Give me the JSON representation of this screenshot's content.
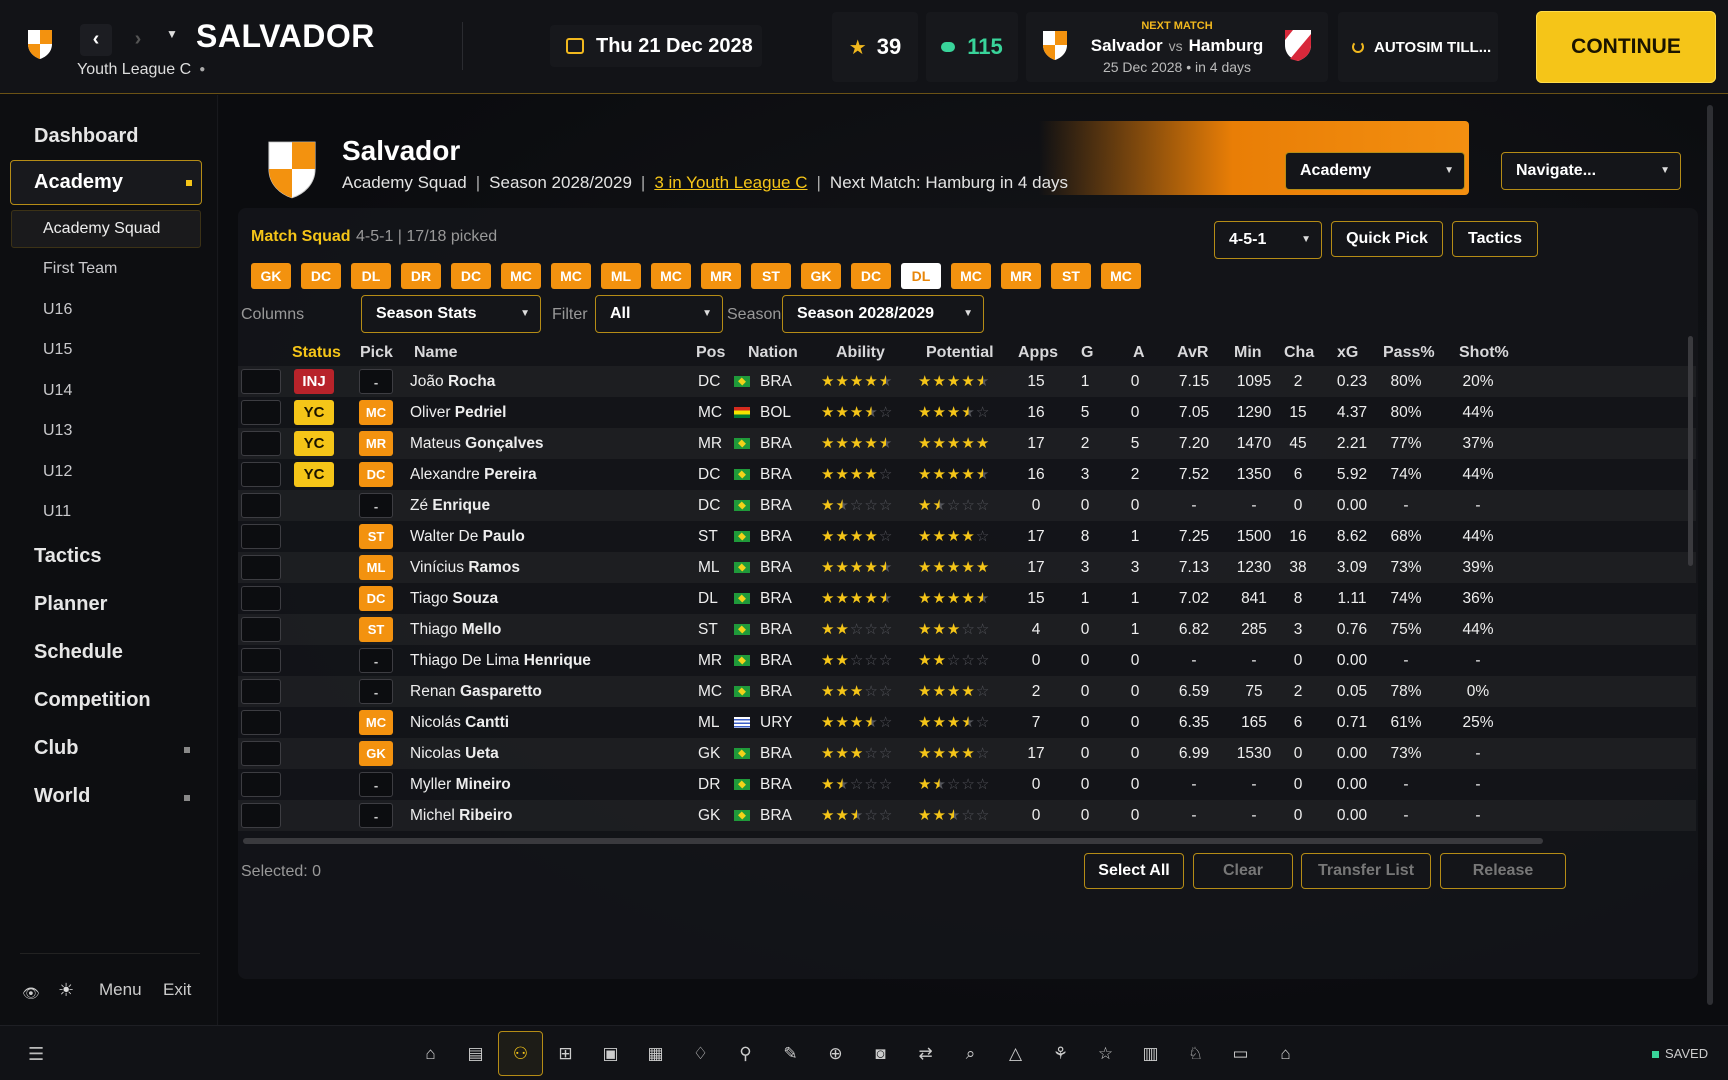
{
  "topbar": {
    "club_name": "SALVADOR",
    "league": "Youth League C",
    "date": "Thu 21 Dec 2028",
    "stars": "39",
    "money": "115",
    "next_match": {
      "label": "NEXT MATCH",
      "home": "Salvador",
      "vs": "vs",
      "away": "Hamburg",
      "when": "25 Dec 2028 • in 4 days"
    },
    "autosim": "AUTOSIM TILL...",
    "continue": "CONTINUE"
  },
  "sidebar": {
    "dashboard": "Dashboard",
    "academy": "Academy",
    "academy_sub": [
      "Academy Squad",
      "First Team",
      "U16",
      "U15",
      "U14",
      "U13",
      "U12",
      "U11"
    ],
    "tactics": "Tactics",
    "planner": "Planner",
    "schedule": "Schedule",
    "competition": "Competition",
    "club": "Club",
    "world": "World",
    "menu": "Menu",
    "exit": "Exit"
  },
  "header": {
    "title": "Salvador",
    "squad": "Academy Squad",
    "season": "Season 2028/2029",
    "position": "3 in Youth League C",
    "next_match": "Next Match: Hamburg in 4 days",
    "section_select": "Academy",
    "navigate_select": "Navigate..."
  },
  "squad": {
    "label": "Match Squad",
    "meta": "4-5-1 | 17/18 picked",
    "formation": "4-5-1",
    "quick_pick": "Quick Pick",
    "tactics": "Tactics",
    "chips": [
      "GK",
      "DC",
      "DL",
      "DR",
      "DC",
      "MC",
      "MC",
      "ML",
      "MC",
      "MR",
      "ST",
      "GK",
      "DC",
      "DL",
      "MC",
      "MR",
      "ST",
      "MC"
    ],
    "selected_chip_index": 13,
    "columns_label": "Columns",
    "columns_value": "Season Stats",
    "filter_label": "Filter",
    "filter_value": "All",
    "season_label": "Season",
    "season_value": "Season 2028/2029"
  },
  "table": {
    "headers": {
      "status": "Status",
      "pick": "Pick",
      "name": "Name",
      "pos": "Pos",
      "nation": "Nation",
      "ability": "Ability",
      "potential": "Potential",
      "apps": "Apps",
      "g": "G",
      "a": "A",
      "avr": "AvR",
      "min": "Min",
      "cha": "Cha",
      "xg": "xG",
      "pass": "Pass%",
      "shot": "Shot%"
    },
    "rows": [
      {
        "status": "INJ",
        "pick": "-",
        "first": "João",
        "last": "Rocha",
        "pos": "DC",
        "nation": "BRA",
        "flag": "bra",
        "ability": 4.5,
        "potential": 4.5,
        "apps": "15",
        "g": "1",
        "a": "0",
        "avr": "7.15",
        "min": "1095",
        "cha": "2",
        "xg": "0.23",
        "pass": "80%",
        "shot": "20%"
      },
      {
        "status": "YC",
        "pick": "MC",
        "first": "Oliver",
        "last": "Pedriel",
        "pos": "MC",
        "nation": "BOL",
        "flag": "bol",
        "ability": 3.5,
        "potential": 3.5,
        "apps": "16",
        "g": "5",
        "a": "0",
        "avr": "7.05",
        "min": "1290",
        "cha": "15",
        "xg": "4.37",
        "pass": "80%",
        "shot": "44%"
      },
      {
        "status": "YC",
        "pick": "MR",
        "first": "Mateus",
        "last": "Gonçalves",
        "pos": "MR",
        "nation": "BRA",
        "flag": "bra",
        "ability": 4.5,
        "potential": 5,
        "apps": "17",
        "g": "2",
        "a": "5",
        "avr": "7.20",
        "min": "1470",
        "cha": "45",
        "xg": "2.21",
        "pass": "77%",
        "shot": "37%"
      },
      {
        "status": "YC",
        "pick": "DC",
        "first": "Alexandre",
        "last": "Pereira",
        "pos": "DC",
        "nation": "BRA",
        "flag": "bra",
        "ability": 4,
        "potential": 4.5,
        "apps": "16",
        "g": "3",
        "a": "2",
        "avr": "7.52",
        "min": "1350",
        "cha": "6",
        "xg": "5.92",
        "pass": "74%",
        "shot": "44%"
      },
      {
        "status": "",
        "pick": "-",
        "first": "Zé",
        "last": "Enrique",
        "pos": "DC",
        "nation": "BRA",
        "flag": "bra",
        "ability": 1.5,
        "potential": 1.5,
        "apps": "0",
        "g": "0",
        "a": "0",
        "avr": "-",
        "min": "-",
        "cha": "0",
        "xg": "0.00",
        "pass": "-",
        "shot": "-"
      },
      {
        "status": "",
        "pick": "ST",
        "first": "Walter De",
        "last": "Paulo",
        "pos": "ST",
        "nation": "BRA",
        "flag": "bra",
        "ability": 4,
        "potential": 4,
        "apps": "17",
        "g": "8",
        "a": "1",
        "avr": "7.25",
        "min": "1500",
        "cha": "16",
        "xg": "8.62",
        "pass": "68%",
        "shot": "44%"
      },
      {
        "status": "",
        "pick": "ML",
        "first": "Vinícius",
        "last": "Ramos",
        "pos": "ML",
        "nation": "BRA",
        "flag": "bra",
        "ability": 4.5,
        "potential": 5,
        "apps": "17",
        "g": "3",
        "a": "3",
        "avr": "7.13",
        "min": "1230",
        "cha": "38",
        "xg": "3.09",
        "pass": "73%",
        "shot": "39%"
      },
      {
        "status": "",
        "pick": "DC",
        "first": "Tiago",
        "last": "Souza",
        "pos": "DL",
        "nation": "BRA",
        "flag": "bra",
        "ability": 4.5,
        "potential": 4.5,
        "apps": "15",
        "g": "1",
        "a": "1",
        "avr": "7.02",
        "min": "841",
        "cha": "8",
        "xg": "1.11",
        "pass": "74%",
        "shot": "36%"
      },
      {
        "status": "",
        "pick": "ST",
        "first": "Thiago",
        "last": "Mello",
        "pos": "ST",
        "nation": "BRA",
        "flag": "bra",
        "ability": 2,
        "potential": 3,
        "apps": "4",
        "g": "0",
        "a": "1",
        "avr": "6.82",
        "min": "285",
        "cha": "3",
        "xg": "0.76",
        "pass": "75%",
        "shot": "44%"
      },
      {
        "status": "",
        "pick": "-",
        "first": "Thiago De Lima",
        "last": "Henrique",
        "pos": "MR",
        "nation": "BRA",
        "flag": "bra",
        "ability": 2,
        "potential": 2,
        "apps": "0",
        "g": "0",
        "a": "0",
        "avr": "-",
        "min": "-",
        "cha": "0",
        "xg": "0.00",
        "pass": "-",
        "shot": "-"
      },
      {
        "status": "",
        "pick": "-",
        "first": "Renan",
        "last": "Gasparetto",
        "pos": "MC",
        "nation": "BRA",
        "flag": "bra",
        "ability": 3,
        "potential": 4,
        "apps": "2",
        "g": "0",
        "a": "0",
        "avr": "6.59",
        "min": "75",
        "cha": "2",
        "xg": "0.05",
        "pass": "78%",
        "shot": "0%"
      },
      {
        "status": "",
        "pick": "MC",
        "first": "Nicolás",
        "last": "Cantti",
        "pos": "ML",
        "nation": "URY",
        "flag": "ury",
        "ability": 3.5,
        "potential": 3.5,
        "apps": "7",
        "g": "0",
        "a": "0",
        "avr": "6.35",
        "min": "165",
        "cha": "6",
        "xg": "0.71",
        "pass": "61%",
        "shot": "25%"
      },
      {
        "status": "",
        "pick": "GK",
        "first": "Nicolas",
        "last": "Ueta",
        "pos": "GK",
        "nation": "BRA",
        "flag": "bra",
        "ability": 3,
        "potential": 4,
        "apps": "17",
        "g": "0",
        "a": "0",
        "avr": "6.99",
        "min": "1530",
        "cha": "0",
        "xg": "0.00",
        "pass": "73%",
        "shot": "-"
      },
      {
        "status": "",
        "pick": "-",
        "first": "Myller",
        "last": "Mineiro",
        "pos": "DR",
        "nation": "BRA",
        "flag": "bra",
        "ability": 1.5,
        "potential": 1.5,
        "apps": "0",
        "g": "0",
        "a": "0",
        "avr": "-",
        "min": "-",
        "cha": "0",
        "xg": "0.00",
        "pass": "-",
        "shot": "-"
      },
      {
        "status": "",
        "pick": "-",
        "first": "Michel",
        "last": "Ribeiro",
        "pos": "GK",
        "nation": "BRA",
        "flag": "bra",
        "ability": 2.5,
        "potential": 2.5,
        "apps": "0",
        "g": "0",
        "a": "0",
        "avr": "-",
        "min": "-",
        "cha": "0",
        "xg": "0.00",
        "pass": "-",
        "shot": "-"
      }
    ]
  },
  "footer": {
    "selected": "Selected: 0",
    "select_all": "Select All",
    "clear": "Clear",
    "transfer_list": "Transfer List",
    "release": "Release"
  },
  "bottombar": {
    "saved": "SAVED",
    "dock_icons": [
      "home-icon",
      "news-icon",
      "squad-icon",
      "tactics-board-icon",
      "save-icon",
      "calendar-icon",
      "trophy-icon",
      "training-icon",
      "tools-icon",
      "medical-icon",
      "finance-icon",
      "transfers-icon",
      "scouting-icon",
      "warning-icon",
      "network-icon",
      "star-icon",
      "stats-icon",
      "awards-icon",
      "folder-icon",
      "stadium-icon"
    ],
    "active_index": 2
  },
  "colors": {
    "accent": "#f5c518",
    "orange": "#f3920f",
    "injury": "#b8232a",
    "money": "#39d49a"
  }
}
